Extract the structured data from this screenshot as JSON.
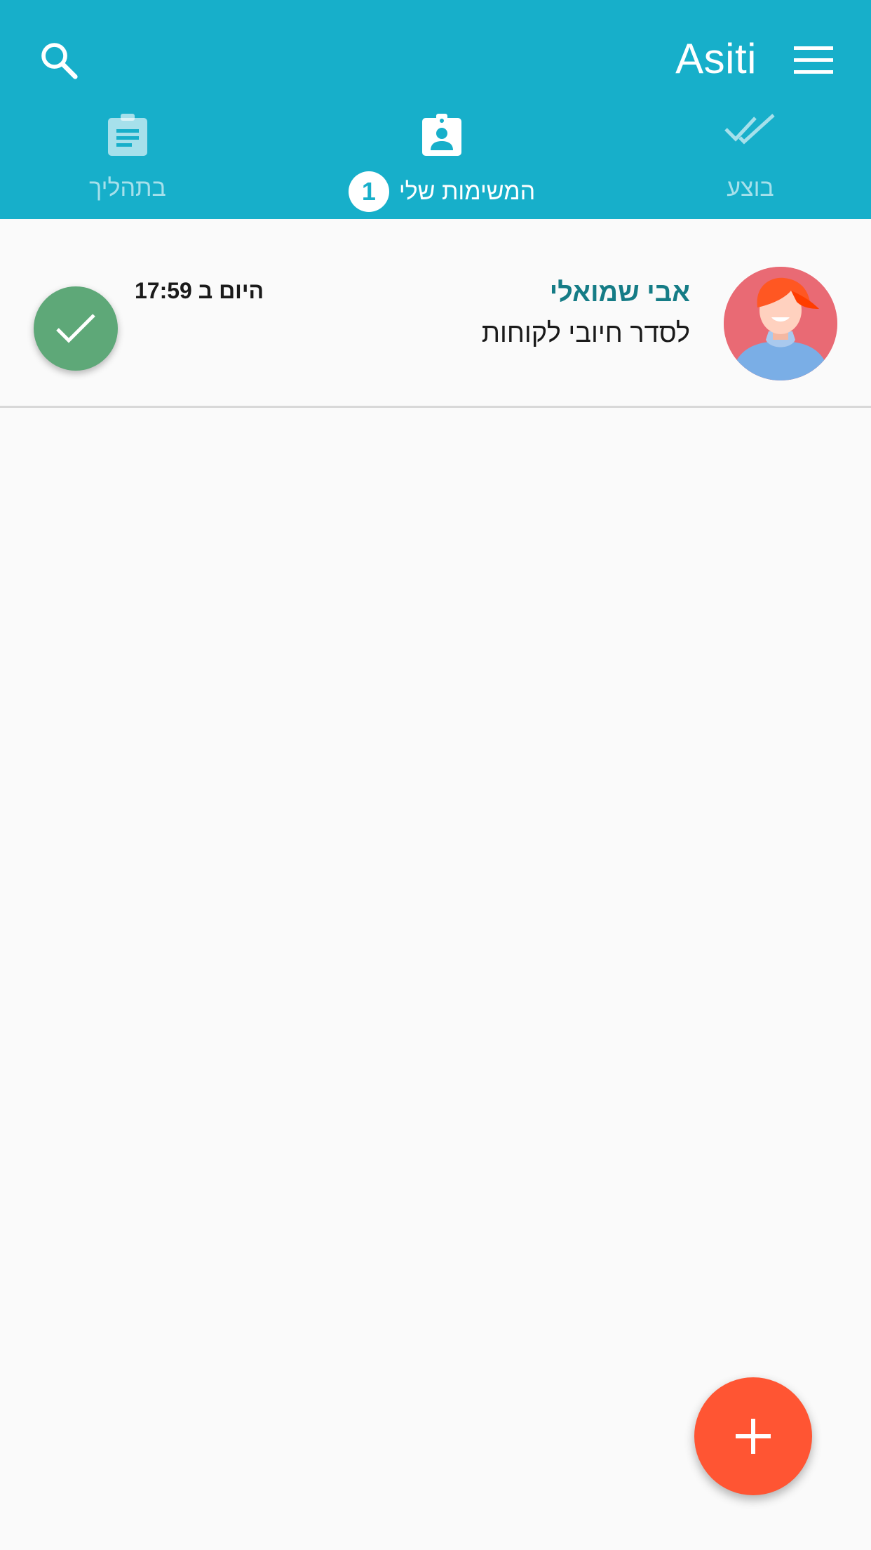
{
  "app_bar": {
    "title": "Asiti",
    "search_icon": "search-icon",
    "menu_icon": "hamburger-menu-icon",
    "background_color": "#17afca"
  },
  "tabs": [
    {
      "label": "בוצע",
      "icon": "double-check-icon",
      "active": false
    },
    {
      "label": "המשימות שלי",
      "icon": "assignment-ind-icon",
      "active": true,
      "badge": "1"
    },
    {
      "label": "בתהליך",
      "icon": "clipboard-list-icon",
      "active": false
    }
  ],
  "tasks": [
    {
      "author": "אבי שמואלי",
      "text": "לסדר חיובי לקוחות",
      "time": "היום ב 17:59",
      "avatar_icon": "user-avatar-icon",
      "action_icon": "check-icon",
      "action_color": "#5ea878"
    }
  ],
  "fab": {
    "icon": "plus-icon",
    "color": "#ff5533"
  }
}
